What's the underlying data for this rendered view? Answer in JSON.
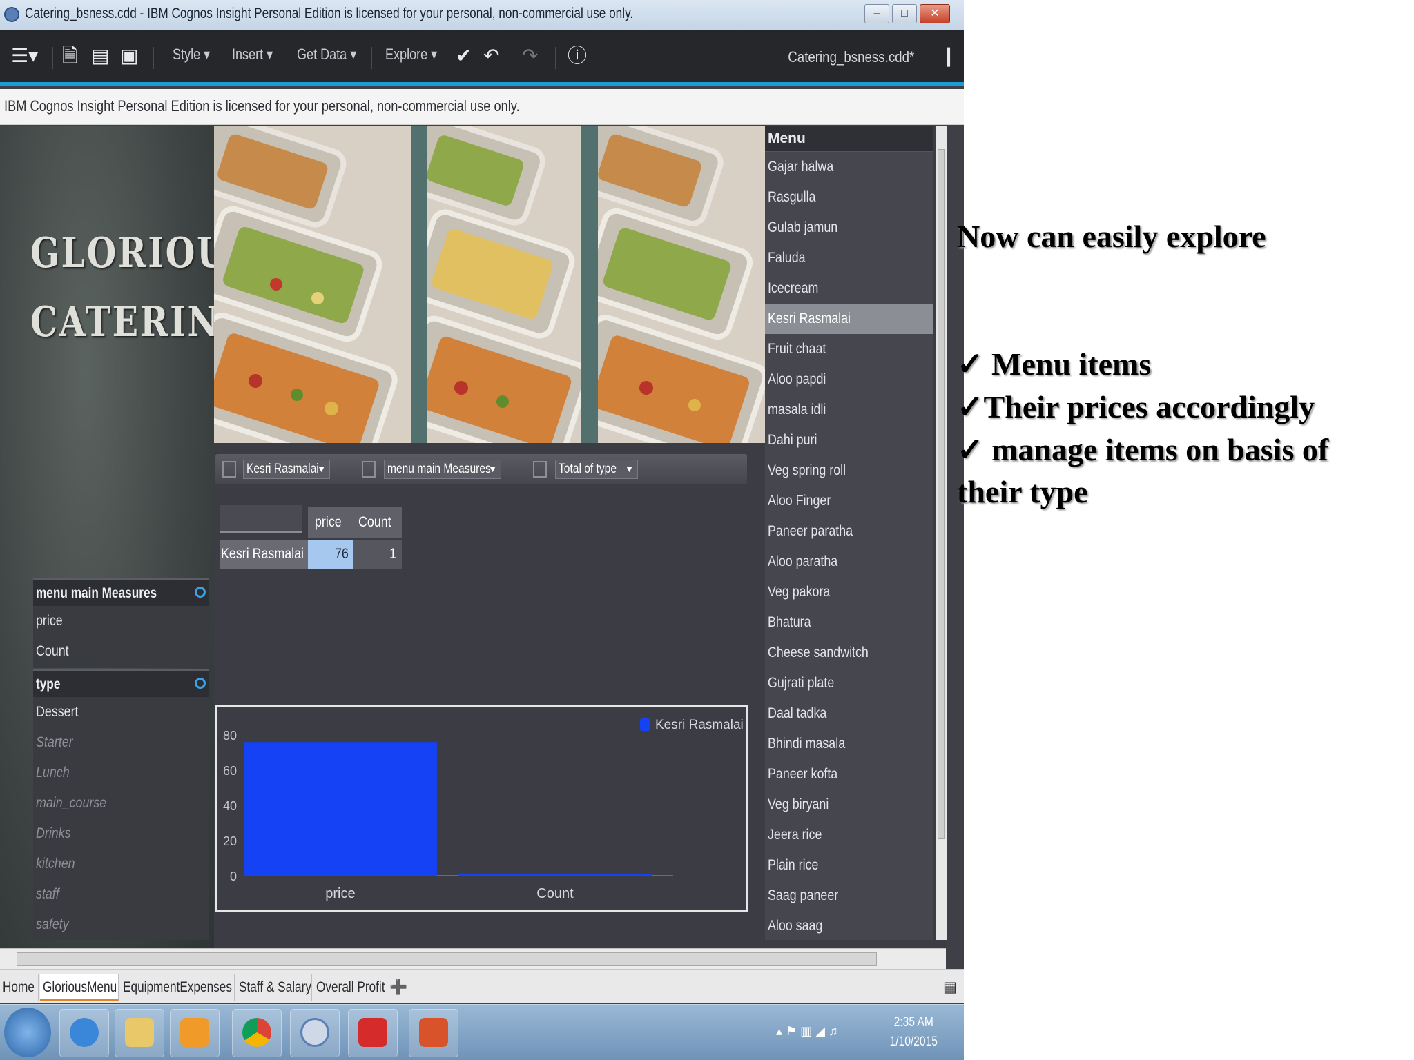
{
  "window": {
    "title": "Catering_bsness.cdd - IBM Cognos Insight Personal Edition is licensed for your personal, non-commercial use only.",
    "controls": [
      "minimize",
      "maximize",
      "close"
    ]
  },
  "toolbar": {
    "menus": [
      "Style",
      "Insert",
      "Get Data",
      "Explore"
    ],
    "file_label": "Catering_bsness.cdd*"
  },
  "license_notice": "IBM Cognos Insight Personal Edition is licensed for your personal, non-commercial use only.",
  "banner": {
    "line1": "GLORIOUS",
    "line2": "CATERING"
  },
  "menu_panel": {
    "header": "Menu",
    "items": [
      "Gajar halwa",
      "Rasgulla",
      "Gulab jamun",
      "Faluda",
      "Icecream",
      "Kesri Rasmalai",
      "Fruit chaat",
      "Aloo papdi",
      "masala idli",
      "Dahi puri",
      "Veg spring roll",
      "Aloo Finger",
      "Paneer paratha",
      "Aloo paratha",
      "Veg pakora",
      "Bhatura",
      "Cheese sandwitch",
      "Gujrati plate",
      "Daal tadka",
      "Bhindi masala",
      "Paneer kofta",
      "Veg biryani",
      "Jeera rice",
      "Plain rice",
      "Saag paneer",
      "Aloo saag"
    ],
    "selected": "Kesri Rasmalai"
  },
  "crosstab": {
    "dropdowns": [
      "Kesri Rasmalai",
      "menu main Measures",
      "Total of type"
    ],
    "columns": [
      "price",
      "Count"
    ],
    "row_label": "Kesri Rasmalai",
    "values": [
      "76",
      "1"
    ]
  },
  "measures_panel": {
    "header": "menu main Measures",
    "items": [
      "price",
      "Count"
    ]
  },
  "type_panel": {
    "header": "type",
    "items": [
      "Dessert",
      "Starter",
      "Lunch",
      "main_course",
      "Drinks",
      "kitchen",
      "staff",
      "safety"
    ]
  },
  "chart_data": {
    "type": "bar",
    "categories": [
      "price",
      "Count"
    ],
    "series": [
      {
        "name": "Kesri Rasmalai",
        "values": [
          76,
          1
        ]
      }
    ],
    "yticks": [
      "0",
      "20",
      "40",
      "60",
      "80"
    ],
    "ylim": [
      0,
      80
    ],
    "legend": "top-right",
    "colors": {
      "bar": "#1542f5"
    }
  },
  "tabs": [
    "Home",
    "GloriousMenu",
    "EquipmentExpenses",
    "Staff & Salary",
    "Overall Profit"
  ],
  "active_tab": "GloriousMenu",
  "taskbar": {
    "time": "2:35 AM",
    "date": "1/10/2015"
  },
  "slide": {
    "heading": "Now can easily explore",
    "bullets": [
      "✓ Menu items",
      "✓Their prices accordingly",
      "✓ manage items on basis of",
      "their type"
    ]
  }
}
